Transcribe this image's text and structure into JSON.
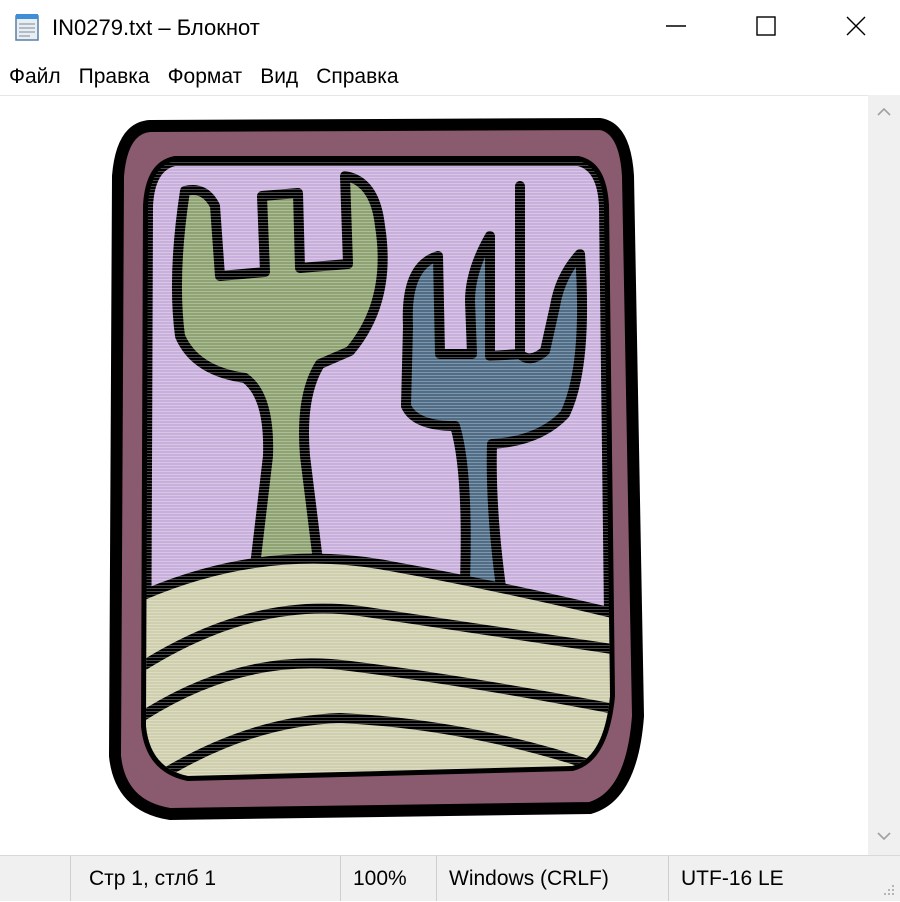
{
  "window": {
    "title": "IN0279.txt – Блокнот",
    "icons": {
      "app": "notepad-icon",
      "minimize": "minimize-icon",
      "maximize": "maximize-icon",
      "close": "close-icon"
    }
  },
  "menu": {
    "items": [
      {
        "label": "Файл"
      },
      {
        "label": "Правка"
      },
      {
        "label": "Формат"
      },
      {
        "label": "Вид"
      },
      {
        "label": "Справка"
      }
    ]
  },
  "artwork": {
    "icon": "forks-on-hills-emblem-icon",
    "colors": {
      "frame": "#8a5a6e",
      "sky": "#c9b0dc",
      "left_fork": "#8fa372",
      "right_fork": "#4f6d86",
      "hills": "#cfcfae",
      "outline": "#000000"
    }
  },
  "status": {
    "position": "Стр 1, стлб 1",
    "zoom": "100%",
    "line_endings": "Windows (CRLF)",
    "encoding": "UTF-16 LE"
  }
}
